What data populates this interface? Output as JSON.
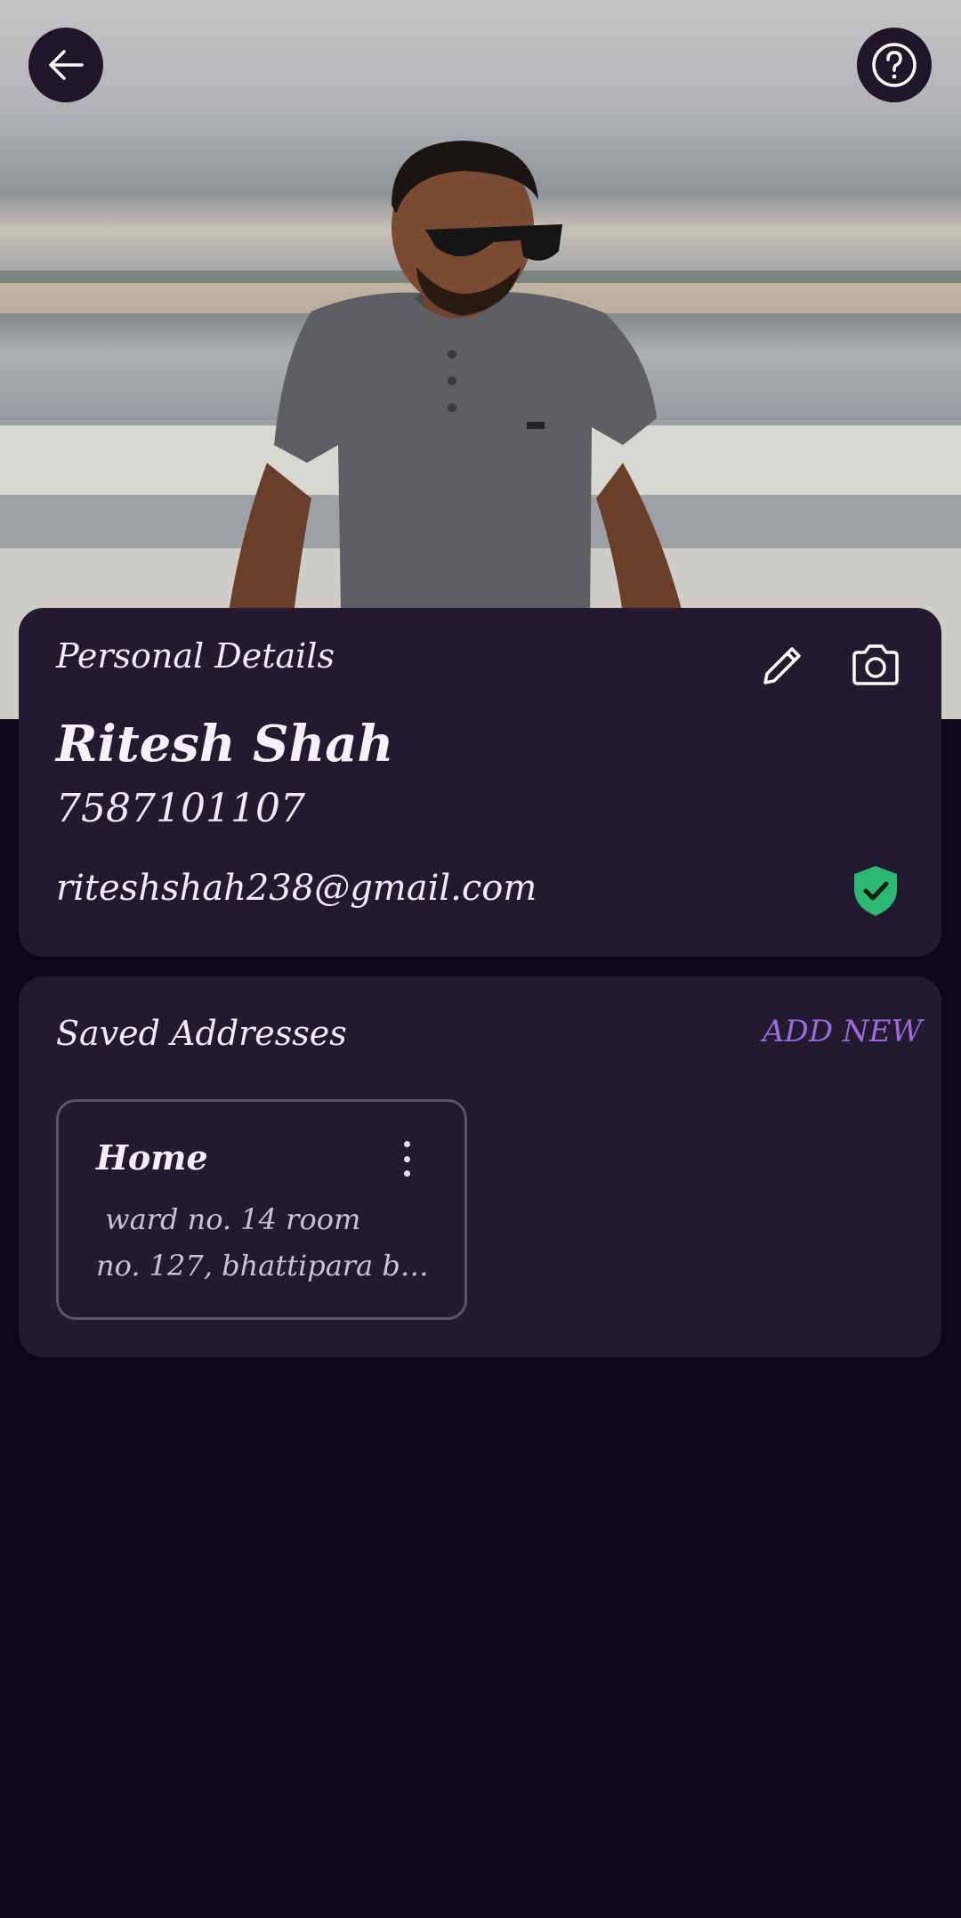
{
  "header": {
    "back_icon": "arrow-left-icon",
    "help_icon": "help-circle-icon"
  },
  "personal": {
    "title": "Personal Details",
    "edit_icon": "pencil-icon",
    "camera_icon": "camera-icon",
    "name": "Ritesh Shah",
    "phone": "7587101107",
    "email": "riteshshah238@gmail.com",
    "verified_icon": "shield-check-icon",
    "verified_color": "#2db872"
  },
  "addresses": {
    "title": "Saved Addresses",
    "add_new_label": "ADD NEW",
    "accent_color": "#9a6ae0",
    "items": [
      {
        "label": "Home",
        "line1": " ward no. 14 room",
        "line2": "no. 127, bhattipara bi...",
        "menu_icon": "more-vertical-icon"
      }
    ]
  },
  "theme": {
    "background": "#10061a",
    "card": "#221a2e"
  }
}
